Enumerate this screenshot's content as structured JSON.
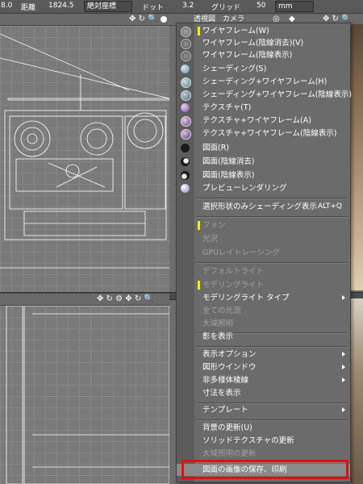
{
  "toolbar": {
    "value_left": "8.0",
    "distance_label": "距離",
    "distance_value": "1824.5",
    "coord_select": "絶対座標",
    "dot_label": "ドット",
    "dot_value": "3.2",
    "grid_label": "グリッド",
    "grid_value": "50",
    "unit_select": "mm"
  },
  "viewport_top_right": {
    "tab_perspective": "透視図",
    "tab_camera": "カメラ"
  },
  "menu": {
    "items": [
      {
        "label": "ワイヤフレーム(W)",
        "marked": true,
        "icon": "wireframe-sphere"
      },
      {
        "label": "ワイヤフレーム(陰線消去)(V)",
        "icon": "wireframe-hidden-sphere"
      },
      {
        "label": "ワイヤフレーム(陰線表示)",
        "icon": "wireframe-show-sphere"
      },
      {
        "label": "シェーディング(S)",
        "icon": "shading-sphere"
      },
      {
        "label": "シェーディング+ワイヤフレーム(H)",
        "icon": "shading-wire-sphere"
      },
      {
        "label": "シェーディング+ワイヤフレーム(陰線表示)",
        "icon": "shading-wire-show-sphere"
      },
      {
        "label": "テクスチャ(T)",
        "icon": "texture-sphere"
      },
      {
        "label": "テクスチャ+ワイヤフレーム(A)",
        "icon": "texture-wire-sphere"
      },
      {
        "label": "テクスチャ+ワイヤフレーム(陰線表示)",
        "icon": "texture-wire-show-sphere"
      },
      {
        "label": "図面(R)",
        "icon": "drawing-sphere"
      },
      {
        "label": "図面(陰線消去)",
        "icon": "drawing-hidden-sphere"
      },
      {
        "label": "図面(陰線表示)",
        "icon": "drawing-show-sphere"
      },
      {
        "label": "プレビューレンダリング",
        "icon": "preview-render-sphere"
      }
    ],
    "selected_shading": {
      "label": "選択形状のみシェーディング表示",
      "shortcut": "ALT+Q"
    },
    "phong": "フォン",
    "gloss": "光沢",
    "gpu_raytracing": "GPUレイトレーシング",
    "default_light": "デフォルトライト",
    "modeling_light": "モデリングライト",
    "modeling_light_type": "モデリングライト タイプ",
    "all_light_sources": "全ての光源",
    "sky_light": "大域照明",
    "show_shadow": "影を表示",
    "display_options": "表示オプション",
    "shape_window": "図形ウインドウ",
    "non_manifold_edges": "非多様体稜線",
    "show_dimensions": "寸法を表示",
    "template": "テンプレート",
    "update_background": "背景の更新(U)",
    "update_solid_texture": "ソリッドテクスチャの更新",
    "update_sky_light": "大域照明の更新",
    "save_print_image": "図面の画像の保存、印刷"
  },
  "colors": {
    "highlight_border": "#e01010",
    "marker": "#f0f000"
  }
}
